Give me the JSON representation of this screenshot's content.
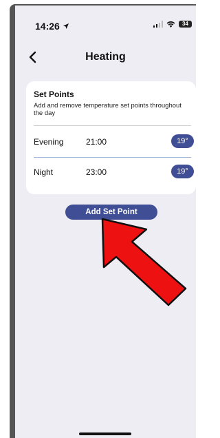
{
  "status_bar": {
    "time": "14:26",
    "battery": "34"
  },
  "nav": {
    "title": "Heating"
  },
  "card": {
    "title": "Set Points",
    "description": "Add and remove temperature set points throughout the day",
    "set_points": [
      {
        "name": "Evening",
        "time": "21:00",
        "temperature": "19°"
      },
      {
        "name": "Night",
        "time": "23:00",
        "temperature": "19°"
      }
    ]
  },
  "actions": {
    "add_set_point_label": "Add Set Point"
  },
  "colors": {
    "accent": "#3f4e95",
    "annotation_arrow": "#ee1111",
    "background": "#eeedf4"
  }
}
